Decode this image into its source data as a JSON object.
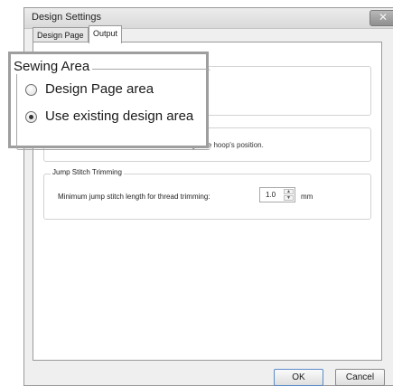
{
  "window": {
    "title": "Design Settings",
    "close_glyph": "✕"
  },
  "tabs": [
    {
      "label": "Design Page",
      "selected": false
    },
    {
      "label": "Output",
      "selected": true
    }
  ],
  "sewing_area": {
    "title": "Sewing Area",
    "options": [
      {
        "label": "Design Page area",
        "checked": false
      },
      {
        "label": "Use existing design area",
        "checked": true
      }
    ]
  },
  "hoop": {
    "partial_text": "ge the hoop's position."
  },
  "jump_stitch": {
    "title": "Jump Stitch Trimming",
    "label": "Minimum jump stitch length for thread trimming:",
    "value": "1.0",
    "unit": "mm"
  },
  "buttons": {
    "ok": "OK",
    "cancel": "Cancel"
  }
}
